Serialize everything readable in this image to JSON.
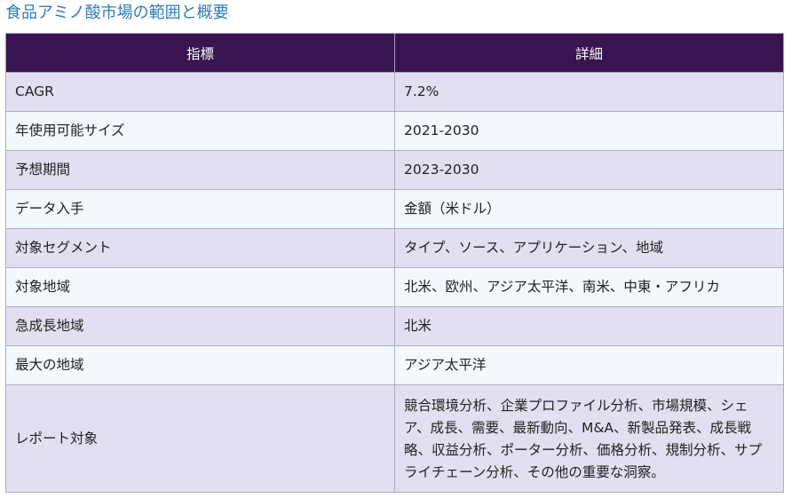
{
  "page_title": "食品アミノ酸市場の範囲と概要",
  "table": {
    "headers": [
      "指標",
      "詳細"
    ],
    "rows": [
      {
        "label": "CAGR",
        "value": "7.2%"
      },
      {
        "label": "年使用可能サイズ",
        "value": "2021-2030"
      },
      {
        "label": "予想期間",
        "value": "2023-2030"
      },
      {
        "label": "データ入手",
        "value": "金額（米ドル）"
      },
      {
        "label": "対象セグメント",
        "value": "タイプ、ソース、アプリケーション、地域"
      },
      {
        "label": "対象地域",
        "value": "北米、欧州、アジア太平洋、南米、中東・アフリカ"
      },
      {
        "label": "急成長地域",
        "value": "北米"
      },
      {
        "label": "最大の地域",
        "value": "アジア太平洋"
      },
      {
        "label": "レポート対象",
        "value": "競合環境分析、企業プロファイル分析、市場規模、シェア、成長、需要、最新動向、M&A、新製品発表、成長戦略、収益分析、ポーター分析、価格分析、規制分析、サプライチェーン分析、その他の重要な洞察。"
      }
    ]
  },
  "colors": {
    "title": "#2d7bbf",
    "header_bg": "#381450",
    "row_odd": "#e3def0",
    "row_even": "#f3f8fb",
    "border": "#b0aac6"
  }
}
